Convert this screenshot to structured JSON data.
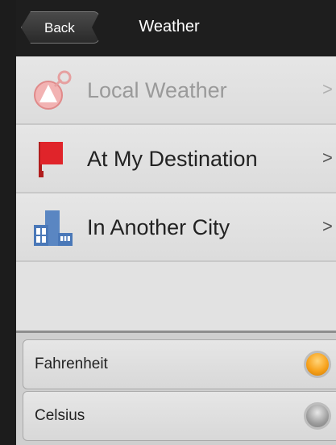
{
  "header": {
    "back_label": "Back",
    "title": "Weather"
  },
  "menu": {
    "items": [
      {
        "label": "Local Weather",
        "icon": "location-pin-icon",
        "chevron": ">",
        "state": "disabled"
      },
      {
        "label": "At My Destination",
        "icon": "red-flag-icon",
        "chevron": ">",
        "state": "enabled"
      },
      {
        "label": "In Another City",
        "icon": "city-buildings-icon",
        "chevron": ">",
        "state": "enabled"
      }
    ]
  },
  "units": {
    "options": [
      {
        "label": "Fahrenheit",
        "selected": true
      },
      {
        "label": "Celsius",
        "selected": false
      }
    ],
    "selected_color": "#f7a21c"
  }
}
